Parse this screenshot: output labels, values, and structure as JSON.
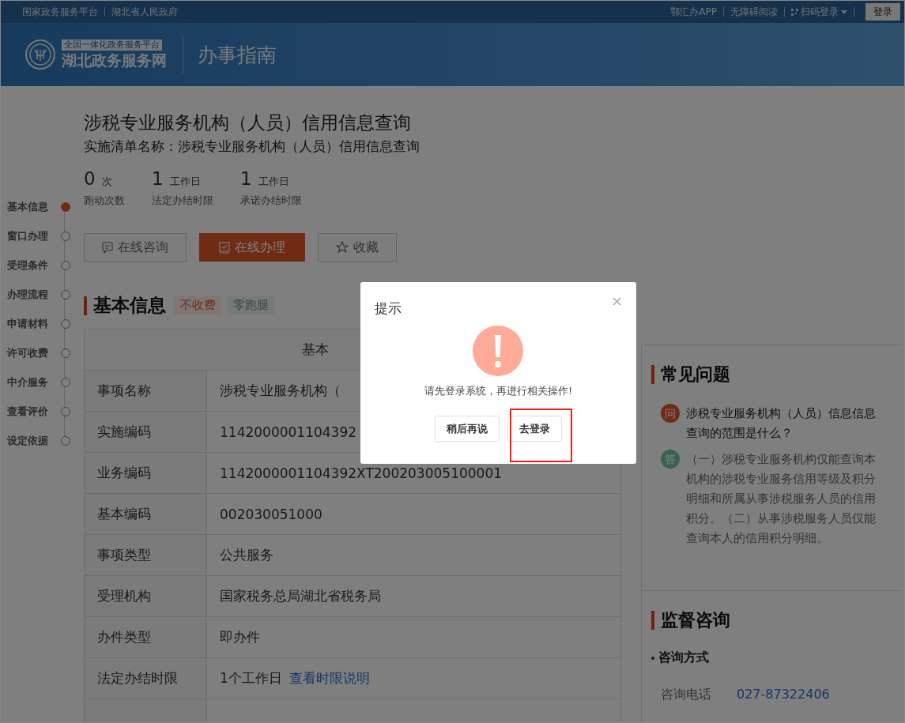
{
  "topbar": {
    "left_links": [
      "国家政务服务平台",
      "湖北省人民政府"
    ],
    "right_links": [
      "鄂汇办APP",
      "无障碍阅读"
    ],
    "qr_login": "扫码登录",
    "login_button": "登录"
  },
  "header": {
    "logo_tagline": "全国一体化政务服务平台",
    "logo_name": "湖北政务服务网",
    "page_title": "办事指南"
  },
  "side_nav": [
    {
      "label": "基本信息",
      "selected": true
    },
    {
      "label": "窗口办理",
      "selected": false
    },
    {
      "label": "受理条件",
      "selected": false
    },
    {
      "label": "办理流程",
      "selected": false
    },
    {
      "label": "申请材料",
      "selected": false
    },
    {
      "label": "许可收费",
      "selected": false
    },
    {
      "label": "中介服务",
      "selected": false
    },
    {
      "label": "查看评价",
      "selected": false
    },
    {
      "label": "设定依据",
      "selected": false
    }
  ],
  "title": "涉税专业服务机构（人员）信用信息查询",
  "subtitle": "实施清单名称：涉税专业服务机构（人员）信用信息查询",
  "stats": [
    {
      "value": "0",
      "unit": "次",
      "label": "跑动次数"
    },
    {
      "value": "1",
      "unit": "工作日",
      "label": "法定办结时限"
    },
    {
      "value": "1",
      "unit": "工作日",
      "label": "承诺办结时限"
    }
  ],
  "actions": [
    {
      "label": "在线咨询",
      "kind": "consult",
      "primary": false
    },
    {
      "label": "在线办理",
      "kind": "handle",
      "primary": true
    },
    {
      "label": "收藏",
      "kind": "favorite",
      "primary": false
    }
  ],
  "section": {
    "title": "基本信息",
    "tags": [
      {
        "label": "不收费",
        "kind": "fee"
      },
      {
        "label": "零跑腿",
        "kind": "errand"
      }
    ]
  },
  "table": {
    "caption": "基本",
    "rows": [
      {
        "label": "事项名称",
        "value": "涉税专业服务机构（"
      },
      {
        "label": "实施编码",
        "value": "1142000001104392"
      },
      {
        "label": "业务编码",
        "value": "1142000001104392XT200203005100001"
      },
      {
        "label": "基本编码",
        "value": "002030051000"
      },
      {
        "label": "事项类型",
        "value": "公共服务"
      },
      {
        "label": "受理机构",
        "value": "国家税务总局湖北省税务局"
      },
      {
        "label": "办件类型",
        "value": "即办件"
      },
      {
        "label": "法定办结时限",
        "value": "1个工作日",
        "link": "查看时限说明"
      }
    ]
  },
  "faq": {
    "title": "常见问题",
    "question_badge": "问",
    "question": "涉税专业服务机构（人员）信息信息查询的范围是什么？",
    "answer_badge": "答",
    "answer": "（一）涉税专业服务机构仅能查询本机构的涉税专业服务信用等级及积分明细和所属从事涉税服务人员的信用积分。（二）从事涉税服务人员仅能查询本人的信用积分明细。"
  },
  "supervision": {
    "title": "监督咨询",
    "method_heading": "咨询方式",
    "contacts": [
      {
        "label": "咨询电话",
        "value": "027-87322406"
      }
    ]
  },
  "dialog": {
    "title": "提示",
    "message": "请先登录系统，再进行相关操作!",
    "buttons": [
      {
        "label": "稍后再说",
        "highlighted": false
      },
      {
        "label": "去登录",
        "highlighted": true
      }
    ]
  }
}
